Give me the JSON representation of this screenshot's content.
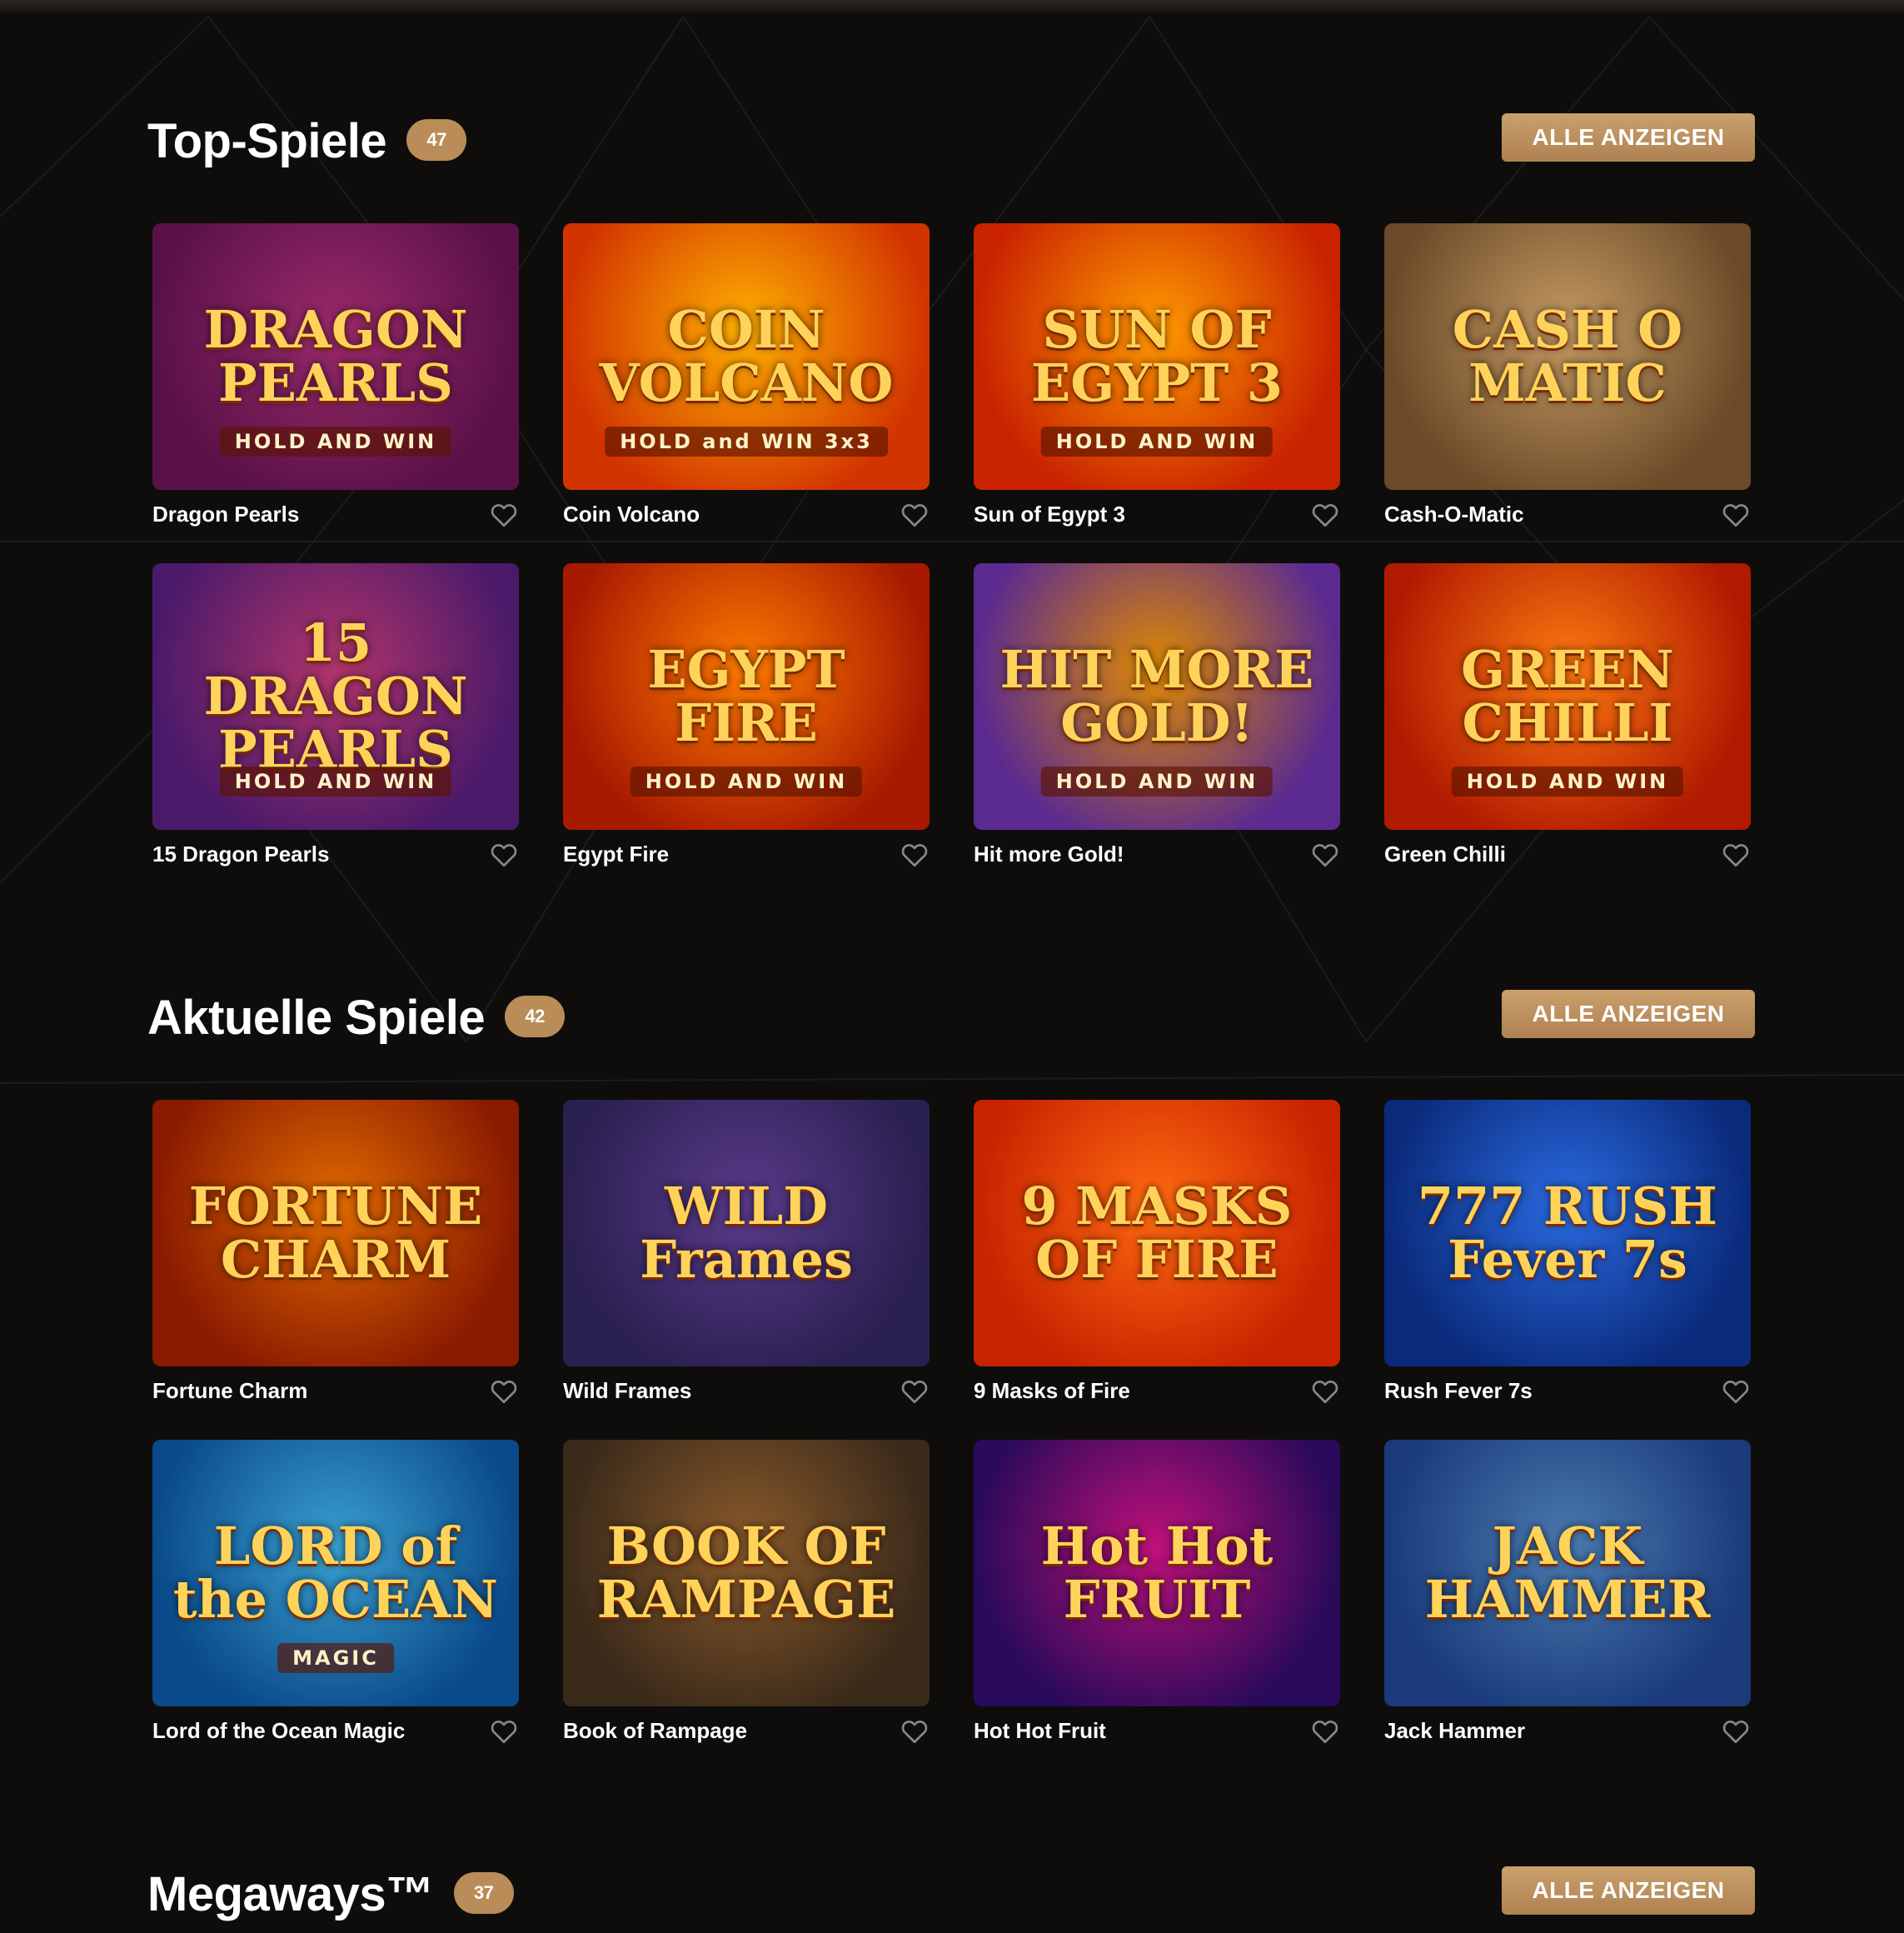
{
  "sections": [
    {
      "title": "Top-Spiele",
      "count": "47",
      "show_all": "ALLE ANZEIGEN",
      "games": [
        {
          "name": "Dragon Pearls",
          "art_title": "DRAGON PEARLS",
          "art_sub": "HOLD AND WIN",
          "bg": "#5a1148",
          "bg2": "#9a2a6a"
        },
        {
          "name": "Coin Volcano",
          "art_title": "COIN VOLCANO",
          "art_sub": "HOLD and WIN 3x3",
          "bg": "#d23400",
          "bg2": "#ffb000"
        },
        {
          "name": "Sun of Egypt 3",
          "art_title": "SUN OF EGYPT 3",
          "art_sub": "HOLD AND WIN",
          "bg": "#c92200",
          "bg2": "#ff9a00"
        },
        {
          "name": "Cash-O-Matic",
          "art_title": "CASH O MATIC",
          "art_sub": "",
          "bg": "#6a4a28",
          "bg2": "#c59a62"
        },
        {
          "name": "15 Dragon Pearls",
          "art_title": "15 DRAGON PEARLS",
          "art_sub": "HOLD AND WIN",
          "bg": "#4a1a6a",
          "bg2": "#b0346a"
        },
        {
          "name": "Egypt Fire",
          "art_title": "EGYPT FIRE",
          "art_sub": "HOLD AND WIN",
          "bg": "#a81a00",
          "bg2": "#ff7a00"
        },
        {
          "name": "Hit more Gold!",
          "art_title": "HIT MORE GOLD!",
          "art_sub": "HOLD AND WIN",
          "bg": "#5a2a90",
          "bg2": "#e08a00"
        },
        {
          "name": "Green Chilli",
          "art_title": "GREEN CHILLI",
          "art_sub": "HOLD AND WIN",
          "bg": "#b01a00",
          "bg2": "#ff7a10"
        }
      ]
    },
    {
      "title": "Aktuelle Spiele",
      "count": "42",
      "show_all": "ALLE ANZEIGEN",
      "games": [
        {
          "name": "Fortune Charm",
          "art_title": "FORTUNE CHARM",
          "art_sub": "",
          "bg": "#8a1a00",
          "bg2": "#e06a00"
        },
        {
          "name": "Wild Frames",
          "art_title": "WILD Frames",
          "art_sub": "",
          "bg": "#2a2050",
          "bg2": "#5a3a8a"
        },
        {
          "name": "9 Masks of Fire",
          "art_title": "9 MASKS OF FIRE",
          "art_sub": "",
          "bg": "#c82200",
          "bg2": "#ff6a10"
        },
        {
          "name": "Rush Fever 7s",
          "art_title": "777 RUSH Fever 7s",
          "art_sub": "",
          "bg": "#0a2a7a",
          "bg2": "#2a6ae0"
        },
        {
          "name": "Lord of the Ocean Magic",
          "art_title": "LORD of the OCEAN",
          "art_sub": "MAGIC",
          "bg": "#0a4a8a",
          "bg2": "#3aa0d0"
        },
        {
          "name": "Book of Rampage",
          "art_title": "BOOK OF RAMPAGE",
          "art_sub": "",
          "bg": "#3a2a1a",
          "bg2": "#8a5a2a"
        },
        {
          "name": "Hot Hot Fruit",
          "art_title": "Hot Hot FRUIT",
          "art_sub": "",
          "bg": "#2a0a5a",
          "bg2": "#c0107a"
        },
        {
          "name": "Jack Hammer",
          "art_title": "JACK HAMMER",
          "art_sub": "",
          "bg": "#1a3a7a",
          "bg2": "#4a7ab0"
        }
      ]
    },
    {
      "title": "Megaways™",
      "count": "37",
      "show_all": "ALLE ANZEIGEN",
      "games": []
    }
  ],
  "icons": {
    "favorite": "heart-outline-icon"
  },
  "colors": {
    "accent": "#b98c58",
    "background": "#0e0d0c"
  }
}
